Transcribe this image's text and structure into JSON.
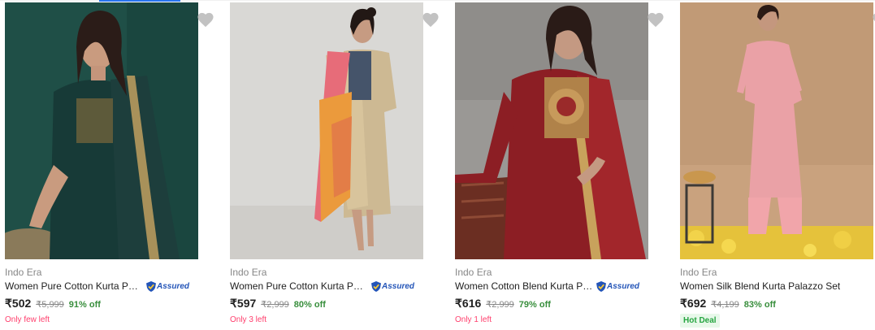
{
  "colors": {
    "price": "#212121",
    "discount": "#388e3c",
    "stock_warning": "#ff3e6c",
    "hot_deal_text": "#26a541",
    "hot_deal_bg": "#e8f8ea",
    "brand_text": "#878787"
  },
  "products": [
    {
      "brand": "Indo Era",
      "title": "Women Pure Cotton Kurta Pant ...",
      "assured_label": "Assured",
      "price": "₹502",
      "mrp": "₹5,999",
      "discount": "91% off",
      "stock_note": "Only few left",
      "image_alt": "woman in dark green kurta with dupatta",
      "wishlist_icon": "heart-icon"
    },
    {
      "brand": "Indo Era",
      "title": "Women Pure Cotton Kurta Palaz...",
      "assured_label": "Assured",
      "price": "₹597",
      "mrp": "₹2,999",
      "discount": "80% off",
      "stock_note": "Only 3 left",
      "image_alt": "woman in beige kurta with pink and orange dupatta",
      "wishlist_icon": "heart-icon"
    },
    {
      "brand": "Indo Era",
      "title": "Women Cotton Blend Kurta Pala...",
      "assured_label": "Assured",
      "price": "₹616",
      "mrp": "₹2,999",
      "discount": "79% off",
      "stock_note": "Only 1 left",
      "image_alt": "woman in maroon kurta with dupatta",
      "wishlist_icon": "heart-icon"
    },
    {
      "brand": "Indo Era",
      "title": "Women Silk Blend Kurta Palazzo Set",
      "price": "₹692",
      "mrp": "₹4,199",
      "discount": "83% off",
      "badge": "Hot Deal",
      "image_alt": "woman in pink printed kurta palazzo set",
      "wishlist_icon": "heart-icon"
    }
  ]
}
